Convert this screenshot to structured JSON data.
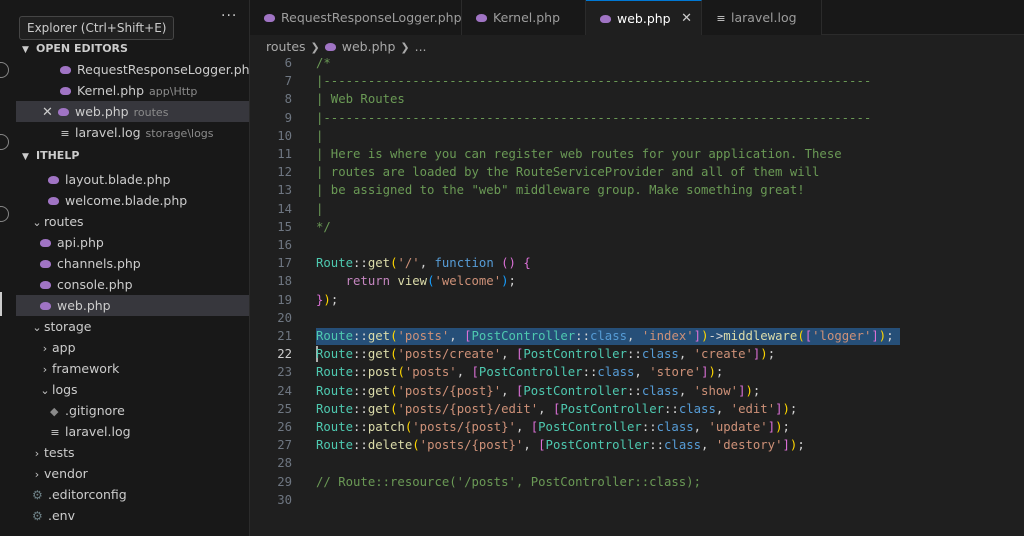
{
  "tooltip": "Explorer (Ctrl+Shift+E)",
  "sidebar": {
    "more": "···",
    "open_editors": {
      "title": "OPEN EDITORS",
      "items": [
        {
          "label": "RequestResponseLogger.php...",
          "desc": "",
          "icon": "php-icon"
        },
        {
          "label": "Kernel.php",
          "desc": "app\\Http",
          "icon": "php-icon"
        },
        {
          "label": "web.php",
          "desc": "routes",
          "icon": "php-icon",
          "active": true
        },
        {
          "label": "laravel.log",
          "desc": "storage\\logs",
          "icon": "log-icon"
        }
      ]
    },
    "project": {
      "title": "ITHELP",
      "items": [
        {
          "label": "layout.blade.php",
          "icon": "php-icon"
        },
        {
          "label": "welcome.blade.php",
          "icon": "php-icon"
        },
        {
          "label": "routes",
          "icon": "folder"
        },
        {
          "label": "api.php",
          "icon": "php-icon"
        },
        {
          "label": "channels.php",
          "icon": "php-icon"
        },
        {
          "label": "console.php",
          "icon": "php-icon"
        },
        {
          "label": "web.php",
          "icon": "php-icon"
        },
        {
          "label": "storage",
          "icon": "folder"
        },
        {
          "label": "app",
          "icon": "folder"
        },
        {
          "label": "framework",
          "icon": "folder"
        },
        {
          "label": "logs",
          "icon": "folder"
        },
        {
          "label": ".gitignore",
          "icon": "diamond-icon"
        },
        {
          "label": "laravel.log",
          "icon": "log-icon"
        },
        {
          "label": "tests",
          "icon": "folder"
        },
        {
          "label": "vendor",
          "icon": "folder"
        },
        {
          "label": ".editorconfig",
          "icon": "gear-icon"
        },
        {
          "label": ".env",
          "icon": "gear-icon"
        }
      ]
    }
  },
  "tabs": [
    {
      "label": "RequestResponseLogger.php",
      "icon": "php-icon"
    },
    {
      "label": "Kernel.php",
      "icon": "php-icon"
    },
    {
      "label": "web.php",
      "icon": "php-icon",
      "active": true
    },
    {
      "label": "laravel.log",
      "icon": "log-icon"
    }
  ],
  "breadcrumb": {
    "folder": "routes",
    "file": "web.php",
    "rest": "..."
  },
  "editor": {
    "line_numbers": [
      "6",
      "7",
      "8",
      "9",
      "10",
      "11",
      "12",
      "13",
      "14",
      "15",
      "16",
      "17",
      "18",
      "19",
      "20",
      "21",
      "22",
      "23",
      "24",
      "25",
      "26",
      "27",
      "28",
      "29",
      "30"
    ],
    "code": {
      "l6": "/*",
      "l7": "|--------------------------------------------------------------------------",
      "l8": "| Web Routes",
      "l9": "|--------------------------------------------------------------------------",
      "l10": "|",
      "l11": "| Here is where you can register web routes for your application. These",
      "l12": "| routes are loaded by the RouteServiceProvider and all of them will",
      "l13": "| be assigned to the \"web\" middleware group. Make something great!",
      "l14": "|",
      "l15": "*/",
      "l29": "// Route::resource('/posts', PostController::class);"
    },
    "tokens": {
      "route": "Route",
      "dc": "::",
      "get": "get",
      "post": "post",
      "patch": "patch",
      "delete": "delete",
      "function": "function",
      "return": "return",
      "view": "view",
      "middleware": "middleware",
      "postcontroller": "PostController",
      "class": "class",
      "s_root": "'/'",
      "s_welcome": "'welcome'",
      "s_posts": "'posts'",
      "s_posts_create": "'posts/create'",
      "s_posts_post": "'posts/{post}'",
      "s_posts_post_edit": "'posts/{post}/edit'",
      "s_index": "'index'",
      "s_create": "'create'",
      "s_store": "'store'",
      "s_show": "'show'",
      "s_edit": "'edit'",
      "s_update": "'update'",
      "s_destory": "'destory'",
      "s_logger": "'logger'"
    }
  }
}
